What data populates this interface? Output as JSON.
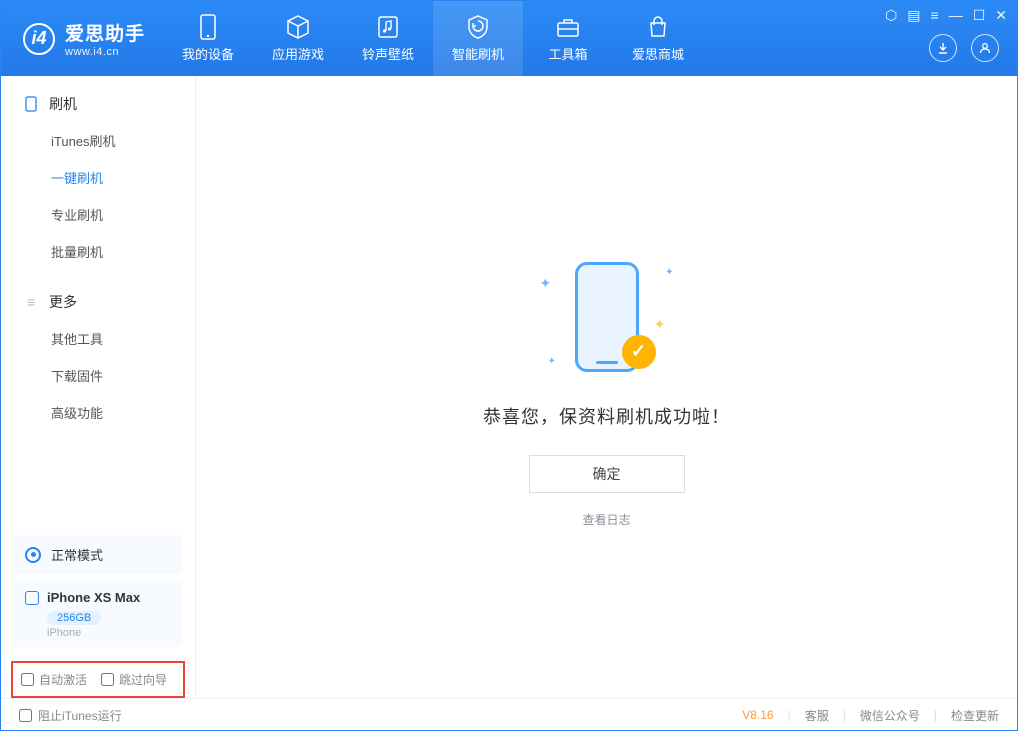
{
  "app": {
    "name_cn": "爱思助手",
    "name_en": "www.i4.cn"
  },
  "nav": [
    {
      "label": "我的设备",
      "icon": "device-icon"
    },
    {
      "label": "应用游戏",
      "icon": "cube-icon"
    },
    {
      "label": "铃声壁纸",
      "icon": "music-icon"
    },
    {
      "label": "智能刷机",
      "icon": "flash-icon",
      "active": true
    },
    {
      "label": "工具箱",
      "icon": "toolbox-icon"
    },
    {
      "label": "爱思商城",
      "icon": "shop-icon"
    }
  ],
  "sidebar": {
    "sections": [
      {
        "title": "刷机",
        "icon": "phone-icon",
        "items": [
          "iTunes刷机",
          "一键刷机",
          "专业刷机",
          "批量刷机"
        ],
        "activeIndex": 1
      },
      {
        "title": "更多",
        "icon": "menu-icon",
        "items": [
          "其他工具",
          "下载固件",
          "高级功能"
        ],
        "activeIndex": -1
      }
    ],
    "mode_label": "正常模式",
    "device": {
      "name": "iPhone XS Max",
      "capacity": "256GB",
      "type": "iPhone"
    },
    "options": {
      "auto_activate": "自动激活",
      "skip_guide": "跳过向导"
    }
  },
  "main": {
    "message": "恭喜您，保资料刷机成功啦！",
    "ok_button": "确定",
    "view_log": "查看日志"
  },
  "footer": {
    "block_itunes": "阻止iTunes运行",
    "version": "V8.16",
    "links": [
      "客服",
      "微信公众号",
      "检查更新"
    ]
  }
}
